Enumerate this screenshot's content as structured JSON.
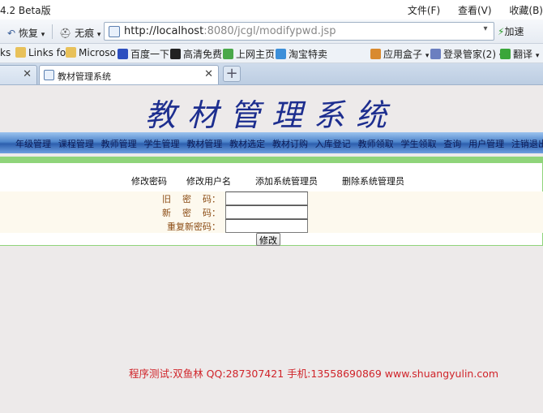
{
  "browser": {
    "title": "4.2 Beta版",
    "menu": [
      "文件(F)",
      "查看(V)",
      "收藏(B)"
    ],
    "toolbar": {
      "restore_label": "恢复",
      "nomark_label": "无痕",
      "url_host": "http://localhost",
      "url_rest": ":8080/jcgl/modifypwd.jsp",
      "accelerate_label": "加速"
    },
    "bookmarks": [
      "ks",
      "Links fo",
      "Microso",
      "百度一下",
      "高清免费",
      "上网主页",
      "淘宝特卖",
      "应用盒子",
      "登录管家(2)",
      "翻译"
    ],
    "tabs": [
      {
        "label": "",
        "active": false
      },
      {
        "label": "教材管理系统",
        "active": true
      }
    ]
  },
  "app": {
    "title": "教材管理系统",
    "nav": [
      "年级管理",
      "课程管理",
      "教师管理",
      "学生管理",
      "教材管理",
      "教材选定",
      "教材订购",
      "入库登记",
      "教师领取",
      "学生领取",
      "查询",
      "用户管理",
      "注销退出"
    ],
    "subnav": [
      "修改密码",
      "修改用户名",
      "添加系统管理员",
      "删除系统管理员"
    ],
    "form": {
      "fields": [
        {
          "label": "旧    密    码：",
          "value": ""
        },
        {
          "label": "新    密    码：",
          "value": ""
        },
        {
          "label": "重复新密码：",
          "value": ""
        }
      ],
      "submit_label": "修改"
    },
    "footer": "程序测试:双鱼林  QQ:287307421  手机:13558690869 www.shuangyulin.com"
  },
  "colors": {
    "title": "#1d2e8f",
    "nav_bar": "#2d5fae",
    "accent_green": "#8fd47a",
    "footer": "#d0242a",
    "label": "#8a4a12"
  }
}
